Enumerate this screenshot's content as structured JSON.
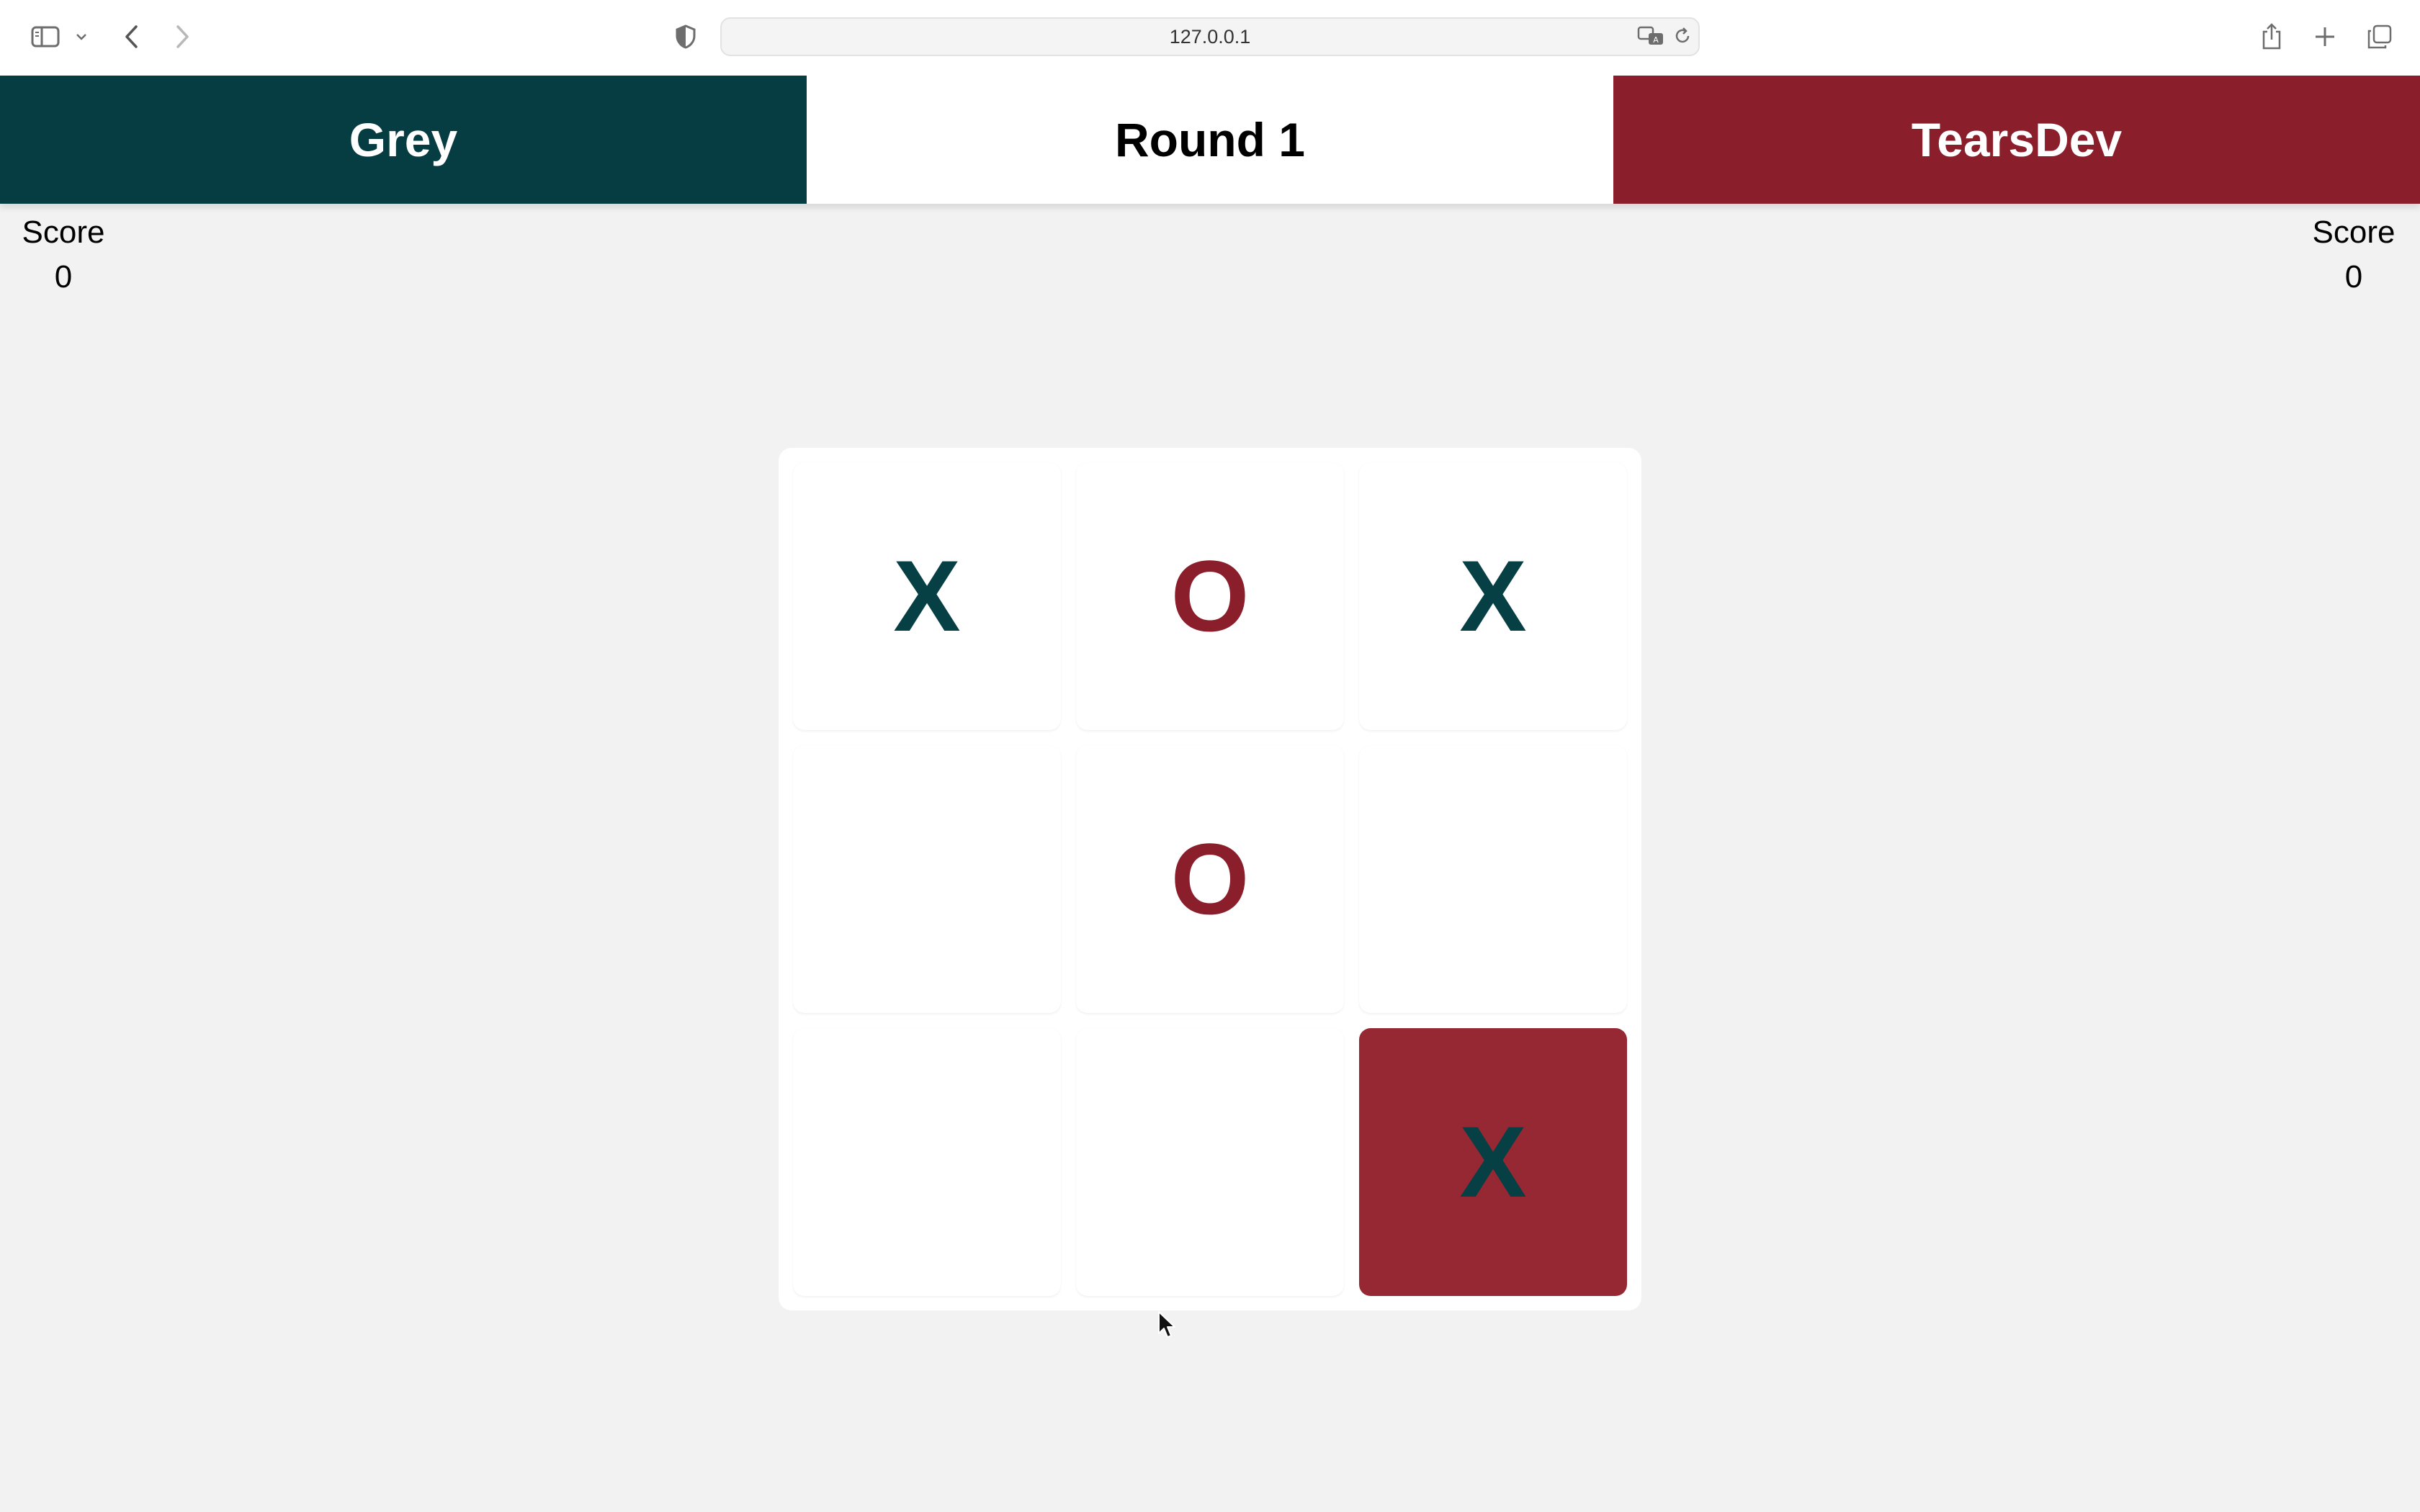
{
  "browser": {
    "url": "127.0.0.1",
    "icons": {
      "sidebar": "sidebar-icon",
      "dropdown": "chevron-down-icon",
      "back": "chevron-left-icon",
      "forward": "chevron-right-icon",
      "privacy": "shield-icon",
      "translate": "translate-icon",
      "reload": "reload-icon",
      "share": "share-icon",
      "new_tab": "plus-icon",
      "tabs": "tabs-overview-icon"
    }
  },
  "header": {
    "player1_name": "Grey",
    "round_label": "Round 1",
    "player2_name": "TearsDev"
  },
  "scores": {
    "left": {
      "label": "Score",
      "value": "0"
    },
    "right": {
      "label": "Score",
      "value": "0"
    }
  },
  "board": {
    "cells": [
      "X",
      "O",
      "X",
      "",
      "O",
      "",
      "",
      "",
      "X"
    ],
    "highlighted_cell": 8
  },
  "colors": {
    "player1": "#053d42",
    "player2": "#8b1e2b",
    "x_mark": "#063f44",
    "o_mark": "#8b1e2b",
    "highlight": "#952833",
    "page_bg": "#f2f2f2"
  }
}
